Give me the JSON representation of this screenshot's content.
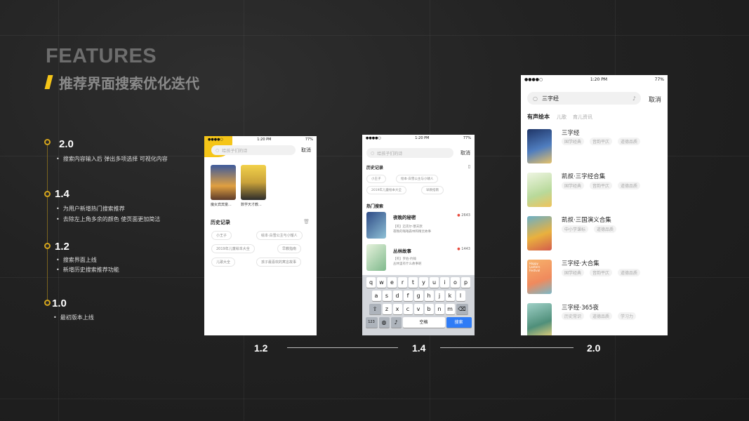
{
  "heading": {
    "title": "FEATURES",
    "subtitle": "推荐界面搜索优化迭代"
  },
  "timeline": [
    {
      "version": "2.0",
      "items": [
        "搜索内容输入后 弹出多项选择 可视化内容"
      ]
    },
    {
      "version": "1.4",
      "items": [
        "为用户新增热门搜索推荐",
        "去除左上角多余的颜色 使页面更加简洁"
      ]
    },
    {
      "version": "1.2",
      "items": [
        "搜索界面上线",
        "新增历史搜索推荐功能"
      ]
    },
    {
      "version": "1.0",
      "items": [
        "最初版本上线"
      ]
    }
  ],
  "bottom_versions": [
    "1.2",
    "1.4",
    "2.0"
  ],
  "status_bar": {
    "time": "1:20 PM",
    "battery": "77%"
  },
  "phone12": {
    "placeholder": "给孩子们的诗",
    "cancel": "取消",
    "books": [
      {
        "title": "魔女宾宾童..."
      },
      {
        "title": "数学天才教..."
      }
    ],
    "history_title": "历史记录",
    "history": [
      "小王子",
      "绘本·白雪公主与小矮人",
      "2019年儿童绘本大全",
      "早教指南",
      "儿歌大全",
      "孩子最喜欢的寓言故事"
    ],
    "colors": {
      "accent": "#f5c518"
    }
  },
  "phone14": {
    "placeholder": "给孩子们的诗",
    "cancel": "取消",
    "history_title": "历史记录",
    "history": [
      "小王子",
      "绘本·白雪公主与小矮人",
      "2019年儿童绘本大全",
      "早教指南"
    ],
    "hot_title": "热门搜索",
    "hot": [
      {
        "title": "夜晚的秘密",
        "count": "2643",
        "line1": "【英】迈克尔·塞夫默",
        "line2": "夜晚的嗡嗡森林和精灵故事"
      },
      {
        "title": "丛林故事",
        "count": "1443",
        "line1": "【英】罗伯·约翰",
        "line2": "丛林里有什么故事呢"
      }
    ],
    "keyboard": {
      "row1": [
        "q",
        "w",
        "e",
        "r",
        "t",
        "y",
        "u",
        "i",
        "o",
        "p"
      ],
      "row2": [
        "a",
        "s",
        "d",
        "f",
        "g",
        "h",
        "j",
        "k",
        "l"
      ],
      "row3": [
        "z",
        "x",
        "c",
        "v",
        "b",
        "n",
        "m"
      ],
      "num": "123",
      "space": "空格",
      "search": "搜索"
    }
  },
  "phone20": {
    "query": "三字经",
    "cancel": "取消",
    "tabs": [
      "有声绘本",
      "儿歌",
      "育儿资讯"
    ],
    "results": [
      {
        "title": "三字经",
        "tags": [
          "国学经典",
          "音韵平仄",
          "道德品质"
        ]
      },
      {
        "title": "凯叔·三字经合集",
        "tags": [
          "国学经典",
          "音韵平仄",
          "道德品质"
        ]
      },
      {
        "title": "凯叔·三国演义合集",
        "tags": [
          "中小学课标",
          "道德品质"
        ]
      },
      {
        "title": "三字经·大合集",
        "tags": [
          "国学经典",
          "音韵平仄",
          "道德品质"
        ]
      },
      {
        "title": "三字经·365夜",
        "tags": [
          "历史常识",
          "道德品质",
          "学习力"
        ]
      }
    ],
    "covers": [
      "#2f4f8a",
      "#e8f0d8",
      "#6ab0c8",
      "#f2b25c",
      "#8fc4c0"
    ],
    "cover_text_4": "Happy Lantern Festival"
  }
}
